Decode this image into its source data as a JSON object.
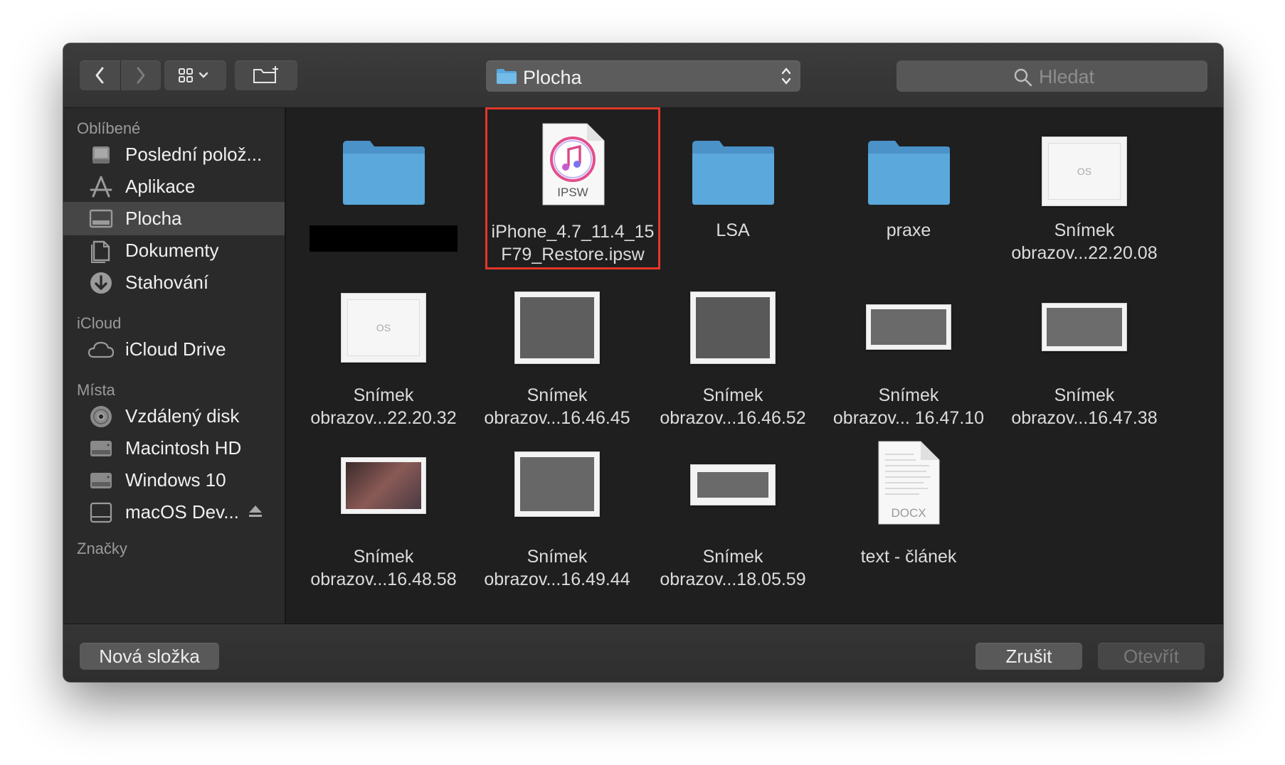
{
  "toolbar": {
    "back_icon": "chevron-left-icon",
    "forward_icon": "chevron-right-icon",
    "view_icon": "icon-grid-view-icon",
    "new_folder_icon": "new-folder-icon",
    "location": "Plocha",
    "search_placeholder": "Hledat"
  },
  "sidebar": {
    "favorites_header": "Oblíbené",
    "favorites": [
      {
        "label": "Poslední polož...",
        "icon": "recents-icon"
      },
      {
        "label": "Aplikace",
        "icon": "applications-icon"
      },
      {
        "label": "Plocha",
        "icon": "desktop-icon",
        "selected": true
      },
      {
        "label": "Dokumenty",
        "icon": "documents-icon"
      },
      {
        "label": "Stahování",
        "icon": "downloads-icon"
      }
    ],
    "icloud_header": "iCloud",
    "icloud": [
      {
        "label": "iCloud Drive",
        "icon": "cloud-icon"
      }
    ],
    "places_header": "Místa",
    "places": [
      {
        "label": "Vzdálený disk",
        "icon": "remote-disc-icon"
      },
      {
        "label": "Macintosh HD",
        "icon": "hard-drive-icon"
      },
      {
        "label": "Windows 10",
        "icon": "hard-drive-icon"
      },
      {
        "label": "macOS Dev...",
        "icon": "external-drive-icon",
        "eject": true
      }
    ],
    "tags_header": "Značky"
  },
  "files": [
    {
      "name1": "",
      "name2": "",
      "type": "folder",
      "redacted": true
    },
    {
      "name1": "iPhone_4.7_11.4_15",
      "name2": "F79_Restore.ipsw",
      "type": "ipsw",
      "badge": "IPSW",
      "selected": true
    },
    {
      "name1": "LSA",
      "name2": "",
      "type": "folder"
    },
    {
      "name1": "praxe",
      "name2": "",
      "type": "folder"
    },
    {
      "name1": "Snímek",
      "name2": "obrazov...22.20.08",
      "type": "screenshot"
    },
    {
      "name1": "Snímek",
      "name2": "obrazov...22.20.32",
      "type": "screenshot"
    },
    {
      "name1": "Snímek",
      "name2": "obrazov...16.46.45",
      "type": "screenshot"
    },
    {
      "name1": "Snímek",
      "name2": "obrazov...16.46.52",
      "type": "screenshot"
    },
    {
      "name1": "Snímek",
      "name2": "obrazov... 16.47.10",
      "type": "screenshot"
    },
    {
      "name1": "Snímek",
      "name2": "obrazov...16.47.38",
      "type": "screenshot"
    },
    {
      "name1": "Snímek",
      "name2": "obrazov...16.48.58",
      "type": "screenshot"
    },
    {
      "name1": "Snímek",
      "name2": "obrazov...16.49.44",
      "type": "screenshot"
    },
    {
      "name1": "Snímek",
      "name2": "obrazov...18.05.59",
      "type": "screenshot"
    },
    {
      "name1": "text - článek",
      "name2": "",
      "type": "docx",
      "badge": "DOCX"
    }
  ],
  "buttons": {
    "new_folder": "Nová složka",
    "cancel": "Zrušit",
    "open": "Otevřít"
  },
  "colors": {
    "folder_blue": "#5aa8dc",
    "selection_outline": "#e2372a"
  }
}
